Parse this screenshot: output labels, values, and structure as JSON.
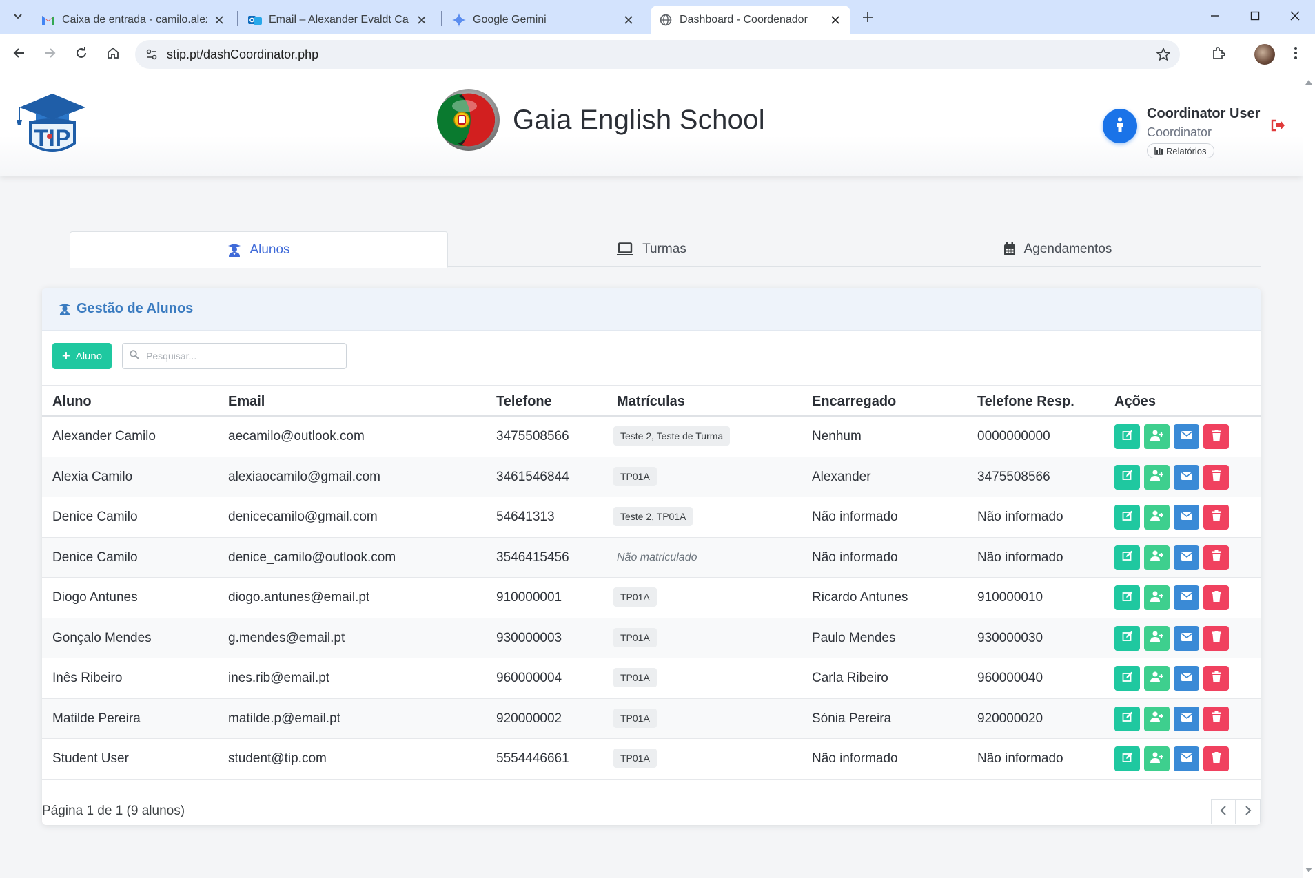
{
  "browser": {
    "tabs": [
      {
        "title": "Caixa de entrada - camilo.alexander",
        "icon": "gmail-icon"
      },
      {
        "title": "Email – Alexander Evaldt Camilo",
        "icon": "outlook-icon"
      },
      {
        "title": "Google Gemini",
        "icon": "gemini-icon"
      },
      {
        "title": "Dashboard - Coordenador",
        "icon": "globe-icon"
      }
    ],
    "url": "stip.pt/dashCoordinator.php"
  },
  "header": {
    "school_name": "Gaia English School",
    "user_name": "Coordinator User",
    "user_role": "Coordinator",
    "reports_label": "Relatórios"
  },
  "nav": {
    "tabs": [
      {
        "label": "Alunos",
        "icon": "graduate-icon",
        "active": true
      },
      {
        "label": "Turmas",
        "icon": "laptop-icon",
        "active": false
      },
      {
        "label": "Agendamentos",
        "icon": "calendar-icon",
        "active": false
      }
    ]
  },
  "students": {
    "card_title": "Gestão de Alunos",
    "add_label": "Aluno",
    "search_placeholder": "Pesquisar...",
    "columns": [
      "Aluno",
      "Email",
      "Telefone",
      "Matrículas",
      "Encarregado",
      "Telefone Resp.",
      "Ações"
    ],
    "rows": [
      {
        "name": "Alexander Camilo",
        "email": "aecamilo@outlook.com",
        "phone": "3475508566",
        "enrollment": "Teste 2, Teste de Turma",
        "enrolled": true,
        "guardian": "Nenhum",
        "guardian_phone": "0000000000"
      },
      {
        "name": "Alexia Camilo",
        "email": "alexiaocamilo@gmail.com",
        "phone": "3461546844",
        "enrollment": "TP01A",
        "enrolled": true,
        "guardian": "Alexander",
        "guardian_phone": "3475508566"
      },
      {
        "name": "Denice Camilo",
        "email": "denicecamilo@gmail.com",
        "phone": "54641313",
        "enrollment": "Teste 2, TP01A",
        "enrolled": true,
        "guardian": "Não informado",
        "guardian_phone": "Não informado"
      },
      {
        "name": "Denice Camilo",
        "email": "denice_camilo@outlook.com",
        "phone": "3546415456",
        "enrollment": "Não matriculado",
        "enrolled": false,
        "guardian": "Não informado",
        "guardian_phone": "Não informado"
      },
      {
        "name": "Diogo Antunes",
        "email": "diogo.antunes@email.pt",
        "phone": "910000001",
        "enrollment": "TP01A",
        "enrolled": true,
        "guardian": "Ricardo Antunes",
        "guardian_phone": "910000010"
      },
      {
        "name": "Gonçalo Mendes",
        "email": "g.mendes@email.pt",
        "phone": "930000003",
        "enrollment": "TP01A",
        "enrolled": true,
        "guardian": "Paulo Mendes",
        "guardian_phone": "930000030"
      },
      {
        "name": "Inês Ribeiro",
        "email": "ines.rib@email.pt",
        "phone": "960000004",
        "enrollment": "TP01A",
        "enrolled": true,
        "guardian": "Carla Ribeiro",
        "guardian_phone": "960000040"
      },
      {
        "name": "Matilde Pereira",
        "email": "matilde.p@email.pt",
        "phone": "920000002",
        "enrollment": "TP01A",
        "enrolled": true,
        "guardian": "Sónia Pereira",
        "guardian_phone": "920000020"
      },
      {
        "name": "Student User",
        "email": "student@tip.com",
        "phone": "5554446661",
        "enrollment": "TP01A",
        "enrolled": true,
        "guardian": "Não informado",
        "guardian_phone": "Não informado"
      }
    ],
    "pagination_text": "Página 1 de 1 (9 alunos)"
  },
  "colors": {
    "accent": "#3f6ad8",
    "edit": "#1fc8a0",
    "assign": "#3ecf8e",
    "mail": "#3a8ad6",
    "delete": "#f0415f"
  }
}
